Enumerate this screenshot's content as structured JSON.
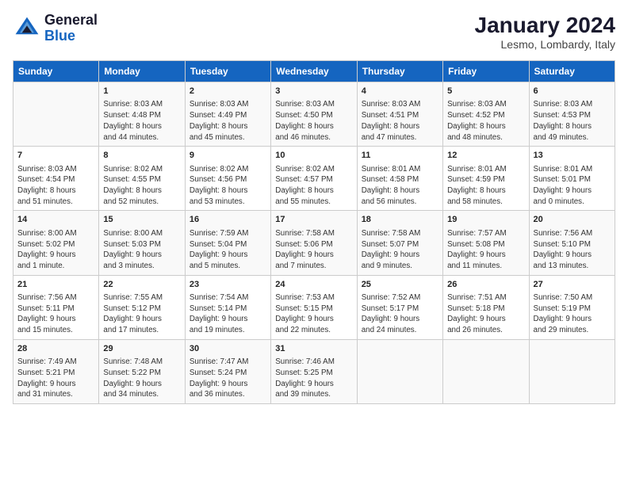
{
  "header": {
    "logo_line1": "General",
    "logo_line2": "Blue",
    "main_title": "January 2024",
    "subtitle": "Lesmo, Lombardy, Italy"
  },
  "days": [
    "Sunday",
    "Monday",
    "Tuesday",
    "Wednesday",
    "Thursday",
    "Friday",
    "Saturday"
  ],
  "weeks": [
    [
      {
        "date": "",
        "text": ""
      },
      {
        "date": "1",
        "text": "Sunrise: 8:03 AM\nSunset: 4:48 PM\nDaylight: 8 hours\nand 44 minutes."
      },
      {
        "date": "2",
        "text": "Sunrise: 8:03 AM\nSunset: 4:49 PM\nDaylight: 8 hours\nand 45 minutes."
      },
      {
        "date": "3",
        "text": "Sunrise: 8:03 AM\nSunset: 4:50 PM\nDaylight: 8 hours\nand 46 minutes."
      },
      {
        "date": "4",
        "text": "Sunrise: 8:03 AM\nSunset: 4:51 PM\nDaylight: 8 hours\nand 47 minutes."
      },
      {
        "date": "5",
        "text": "Sunrise: 8:03 AM\nSunset: 4:52 PM\nDaylight: 8 hours\nand 48 minutes."
      },
      {
        "date": "6",
        "text": "Sunrise: 8:03 AM\nSunset: 4:53 PM\nDaylight: 8 hours\nand 49 minutes."
      }
    ],
    [
      {
        "date": "7",
        "text": "Sunrise: 8:03 AM\nSunset: 4:54 PM\nDaylight: 8 hours\nand 51 minutes."
      },
      {
        "date": "8",
        "text": "Sunrise: 8:02 AM\nSunset: 4:55 PM\nDaylight: 8 hours\nand 52 minutes."
      },
      {
        "date": "9",
        "text": "Sunrise: 8:02 AM\nSunset: 4:56 PM\nDaylight: 8 hours\nand 53 minutes."
      },
      {
        "date": "10",
        "text": "Sunrise: 8:02 AM\nSunset: 4:57 PM\nDaylight: 8 hours\nand 55 minutes."
      },
      {
        "date": "11",
        "text": "Sunrise: 8:01 AM\nSunset: 4:58 PM\nDaylight: 8 hours\nand 56 minutes."
      },
      {
        "date": "12",
        "text": "Sunrise: 8:01 AM\nSunset: 4:59 PM\nDaylight: 8 hours\nand 58 minutes."
      },
      {
        "date": "13",
        "text": "Sunrise: 8:01 AM\nSunset: 5:01 PM\nDaylight: 9 hours\nand 0 minutes."
      }
    ],
    [
      {
        "date": "14",
        "text": "Sunrise: 8:00 AM\nSunset: 5:02 PM\nDaylight: 9 hours\nand 1 minute."
      },
      {
        "date": "15",
        "text": "Sunrise: 8:00 AM\nSunset: 5:03 PM\nDaylight: 9 hours\nand 3 minutes."
      },
      {
        "date": "16",
        "text": "Sunrise: 7:59 AM\nSunset: 5:04 PM\nDaylight: 9 hours\nand 5 minutes."
      },
      {
        "date": "17",
        "text": "Sunrise: 7:58 AM\nSunset: 5:06 PM\nDaylight: 9 hours\nand 7 minutes."
      },
      {
        "date": "18",
        "text": "Sunrise: 7:58 AM\nSunset: 5:07 PM\nDaylight: 9 hours\nand 9 minutes."
      },
      {
        "date": "19",
        "text": "Sunrise: 7:57 AM\nSunset: 5:08 PM\nDaylight: 9 hours\nand 11 minutes."
      },
      {
        "date": "20",
        "text": "Sunrise: 7:56 AM\nSunset: 5:10 PM\nDaylight: 9 hours\nand 13 minutes."
      }
    ],
    [
      {
        "date": "21",
        "text": "Sunrise: 7:56 AM\nSunset: 5:11 PM\nDaylight: 9 hours\nand 15 minutes."
      },
      {
        "date": "22",
        "text": "Sunrise: 7:55 AM\nSunset: 5:12 PM\nDaylight: 9 hours\nand 17 minutes."
      },
      {
        "date": "23",
        "text": "Sunrise: 7:54 AM\nSunset: 5:14 PM\nDaylight: 9 hours\nand 19 minutes."
      },
      {
        "date": "24",
        "text": "Sunrise: 7:53 AM\nSunset: 5:15 PM\nDaylight: 9 hours\nand 22 minutes."
      },
      {
        "date": "25",
        "text": "Sunrise: 7:52 AM\nSunset: 5:17 PM\nDaylight: 9 hours\nand 24 minutes."
      },
      {
        "date": "26",
        "text": "Sunrise: 7:51 AM\nSunset: 5:18 PM\nDaylight: 9 hours\nand 26 minutes."
      },
      {
        "date": "27",
        "text": "Sunrise: 7:50 AM\nSunset: 5:19 PM\nDaylight: 9 hours\nand 29 minutes."
      }
    ],
    [
      {
        "date": "28",
        "text": "Sunrise: 7:49 AM\nSunset: 5:21 PM\nDaylight: 9 hours\nand 31 minutes."
      },
      {
        "date": "29",
        "text": "Sunrise: 7:48 AM\nSunset: 5:22 PM\nDaylight: 9 hours\nand 34 minutes."
      },
      {
        "date": "30",
        "text": "Sunrise: 7:47 AM\nSunset: 5:24 PM\nDaylight: 9 hours\nand 36 minutes."
      },
      {
        "date": "31",
        "text": "Sunrise: 7:46 AM\nSunset: 5:25 PM\nDaylight: 9 hours\nand 39 minutes."
      },
      {
        "date": "",
        "text": ""
      },
      {
        "date": "",
        "text": ""
      },
      {
        "date": "",
        "text": ""
      }
    ]
  ]
}
